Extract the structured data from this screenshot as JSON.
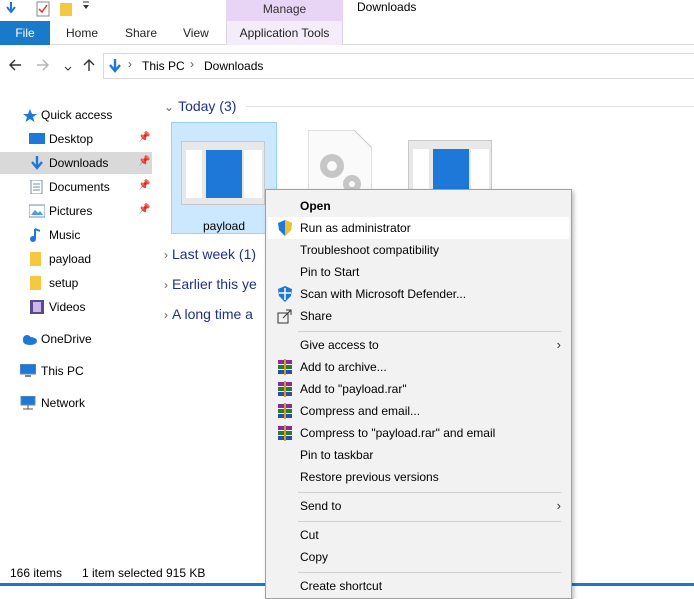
{
  "window": {
    "title": "Downloads",
    "manage_tab": "Manage"
  },
  "ribbon": {
    "file": "File",
    "tabs": [
      "Home",
      "Share",
      "View",
      "Application Tools"
    ]
  },
  "address": {
    "crumbs": [
      "This PC",
      "Downloads"
    ]
  },
  "sidebar": {
    "items": [
      {
        "label": "Quick access",
        "icon": "star-icon",
        "pinned": false
      },
      {
        "label": "Desktop",
        "icon": "desktop-icon",
        "pinned": true
      },
      {
        "label": "Downloads",
        "icon": "download-icon",
        "pinned": true,
        "selected": true
      },
      {
        "label": "Documents",
        "icon": "documents-icon",
        "pinned": true
      },
      {
        "label": "Pictures",
        "icon": "pictures-icon",
        "pinned": true
      },
      {
        "label": "Music",
        "icon": "music-icon",
        "pinned": false
      },
      {
        "label": "payload",
        "icon": "folder-icon",
        "pinned": false
      },
      {
        "label": "setup",
        "icon": "folder-icon",
        "pinned": false
      },
      {
        "label": "Videos",
        "icon": "videos-icon",
        "pinned": false
      },
      {
        "label": "OneDrive",
        "icon": "cloud-icon",
        "pinned": false
      },
      {
        "label": "This PC",
        "icon": "computer-icon",
        "pinned": false
      },
      {
        "label": "Network",
        "icon": "network-icon",
        "pinned": false
      }
    ]
  },
  "content": {
    "groups": [
      {
        "label": "Today (3)",
        "expanded": true
      },
      {
        "label": "Last week (1)",
        "expanded": false
      },
      {
        "label": "Earlier this ye",
        "expanded": false
      },
      {
        "label": "A long time a",
        "expanded": false
      }
    ],
    "files": [
      {
        "name": "payload",
        "selected": true,
        "type": "app"
      },
      {
        "name": "",
        "selected": false,
        "type": "settings"
      },
      {
        "name": "",
        "selected": false,
        "type": "app"
      }
    ]
  },
  "status": {
    "count": "166 items",
    "selection": "1 item selected",
    "size": "915 KB"
  },
  "context_menu": {
    "items": [
      {
        "label": "Open",
        "bold": true
      },
      {
        "label": "Run as administrator",
        "icon": "shield-icon",
        "hover": true
      },
      {
        "label": "Troubleshoot compatibility"
      },
      {
        "label": "Pin to Start"
      },
      {
        "label": "Scan with Microsoft Defender...",
        "icon": "defender-icon"
      },
      {
        "label": "Share",
        "icon": "share-icon"
      },
      {
        "label": "Give access to",
        "submenu": true
      },
      {
        "label": "Add to archive...",
        "icon": "winrar-icon"
      },
      {
        "label": "Add to \"payload.rar\"",
        "icon": "winrar-icon"
      },
      {
        "label": "Compress and email...",
        "icon": "winrar-icon"
      },
      {
        "label": "Compress to \"payload.rar\" and email",
        "icon": "winrar-icon"
      },
      {
        "label": "Pin to taskbar"
      },
      {
        "label": "Restore previous versions"
      },
      {
        "label": "Send to",
        "submenu": true
      },
      {
        "label": "Cut"
      },
      {
        "label": "Copy"
      },
      {
        "label": "Create shortcut"
      }
    ]
  },
  "colors": {
    "accent": "#1979ca",
    "selection": "#cce8ff",
    "group_header": "#1e3287"
  }
}
